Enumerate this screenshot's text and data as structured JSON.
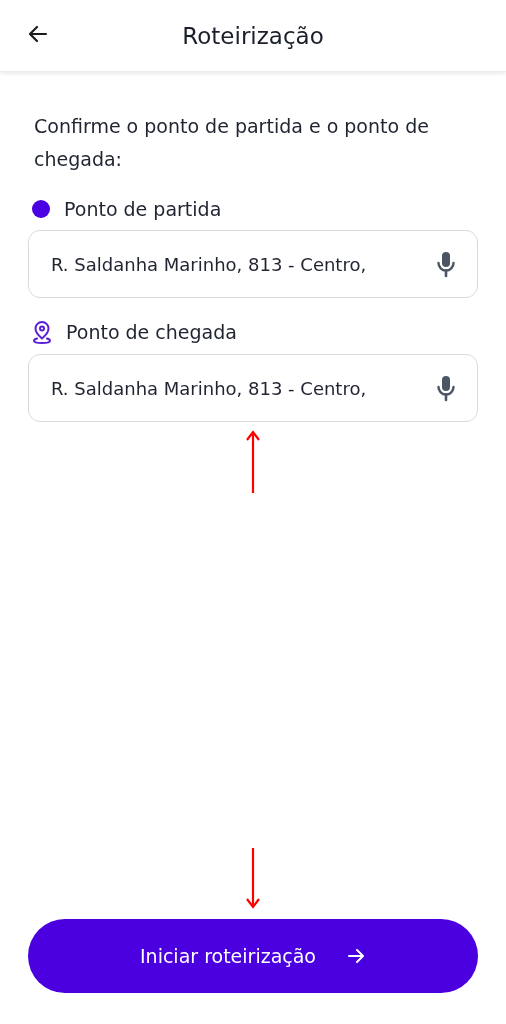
{
  "header": {
    "title": "Roteirização"
  },
  "instruction": "Confirme o ponto de partida e o ponto de chegada:",
  "locations": [
    {
      "kind": "start",
      "label": "Ponto de partida",
      "value": "R. Saldanha Marinho, 813 - Centro,"
    },
    {
      "kind": "end",
      "label": "Ponto de chegada",
      "value": "R. Saldanha Marinho, 813 - Centro,"
    }
  ],
  "primary_button": {
    "label": "Iniciar roteirização"
  }
}
